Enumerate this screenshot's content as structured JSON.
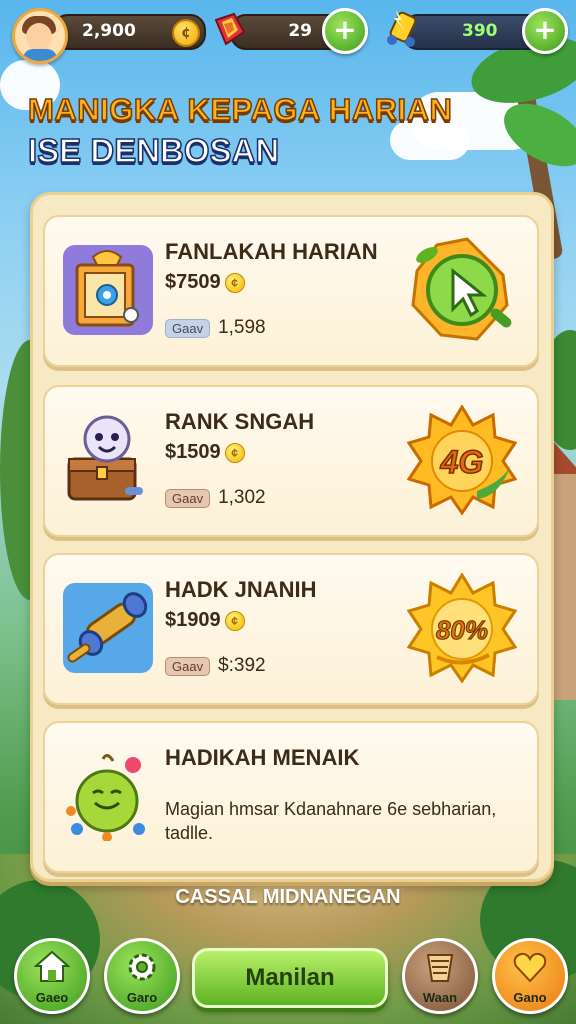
{
  "topbar": {
    "coins": "2,900",
    "gems": "29",
    "energy": "390"
  },
  "header": {
    "title_line1": "MANIGKA KEPAGA HARIAN",
    "title_line2": "ISE DENBOSAN"
  },
  "offers": [
    {
      "name": "FANLAKAH HARIAN",
      "price": "$7509",
      "tag": "Gaav",
      "value": "1,598",
      "badge_text": ""
    },
    {
      "name": "RANK SNGAH",
      "price": "$1509",
      "tag": "Gaav",
      "value": "1,302",
      "badge_text": "4G"
    },
    {
      "name": "HADK JNANIH",
      "price": "$1909",
      "tag": "Gaav",
      "value": "$:392",
      "badge_text": "80%"
    },
    {
      "name": "HADIKAH MENAIK",
      "description": "Magian hmsar Kdanahnare 6e sebharian, tadlle."
    }
  ],
  "footer_text": "CASSAL MIDNANEGAN",
  "nav": {
    "home_label": "Gaeo",
    "settings_label": "Garo",
    "main_label": "Manilan",
    "shop_label": "Waan",
    "heart_label": "Gano"
  },
  "colors": {
    "panel_bg": "#f7e9c3",
    "accent_green": "#5fb323",
    "title_orange": "#ffb21e",
    "coin_gold": "#f0a700"
  }
}
